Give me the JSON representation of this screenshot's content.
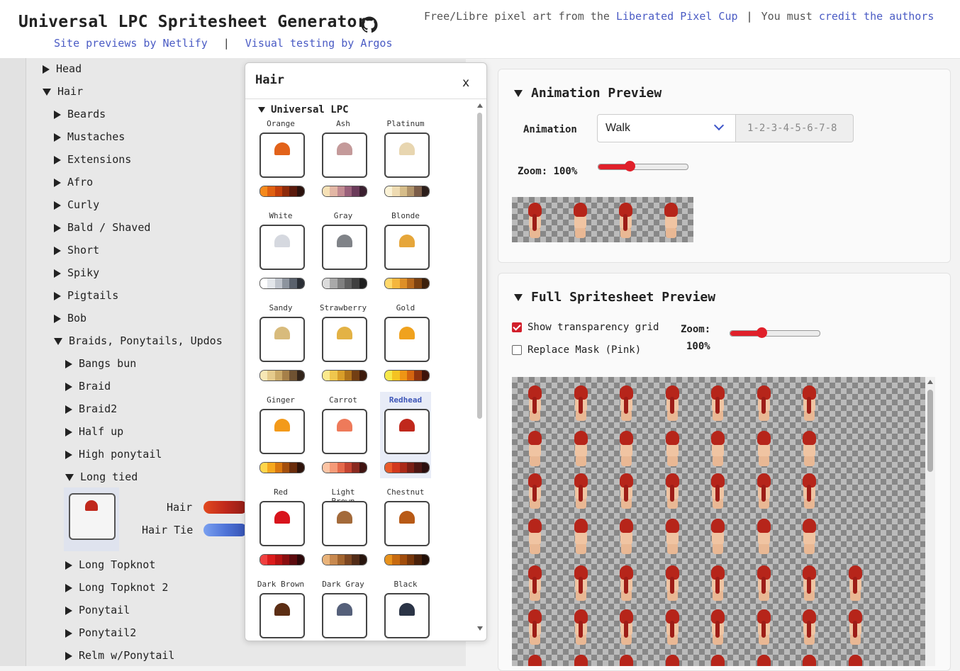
{
  "header": {
    "title": "Universal LPC Spritesheet Generator",
    "link_netlify": "Site previews by Netlify",
    "link_sep": "|",
    "link_argos": "Visual testing by Argos",
    "credit_prefix": "Free/Libre pixel art from the",
    "credit_lpc": "Liberated Pixel Cup",
    "credit_mid": "You must",
    "credit_authors": "credit the authors"
  },
  "tree": {
    "items": [
      {
        "label": "Head",
        "expanded": false
      },
      {
        "label": "Hair",
        "expanded": true
      },
      {
        "label": "Beards",
        "expanded": false
      },
      {
        "label": "Mustaches",
        "expanded": false
      },
      {
        "label": "Extensions",
        "expanded": false
      },
      {
        "label": "Afro",
        "expanded": false
      },
      {
        "label": "Curly",
        "expanded": false
      },
      {
        "label": "Bald / Shaved",
        "expanded": false
      },
      {
        "label": "Short",
        "expanded": false
      },
      {
        "label": "Spiky",
        "expanded": false
      },
      {
        "label": "Pigtails",
        "expanded": false
      },
      {
        "label": "Bob",
        "expanded": false
      },
      {
        "label": "Braids, Ponytails, Updos",
        "expanded": true
      },
      {
        "label": "Bangs bun",
        "expanded": false
      },
      {
        "label": "Braid",
        "expanded": false
      },
      {
        "label": "Braid2",
        "expanded": false
      },
      {
        "label": "Half up",
        "expanded": false
      },
      {
        "label": "High ponytail",
        "expanded": false
      },
      {
        "label": "Long tied",
        "expanded": true
      },
      {
        "label": "Long Topknot",
        "expanded": false
      },
      {
        "label": "Long Topknot 2",
        "expanded": false
      },
      {
        "label": "Ponytail",
        "expanded": false
      },
      {
        "label": "Ponytail2",
        "expanded": false
      },
      {
        "label": "Relm w/Ponytail",
        "expanded": false
      }
    ],
    "selected_labels": {
      "hair": "Hair",
      "hair_tie": "Hair Tie"
    },
    "colors": {
      "hair": "#c83a1e",
      "tie": "#4f74d8"
    }
  },
  "modal": {
    "title": "Hair",
    "close": "x",
    "section": "Universal LPC",
    "selected": "Redhead",
    "variants": [
      {
        "name": "Orange",
        "hair": "#e2621a",
        "pal": [
          "#f58a1c",
          "#e06112",
          "#c3400c",
          "#8e2b0b",
          "#5a1a0c",
          "#2b120d"
        ]
      },
      {
        "name": "Ash",
        "hair": "#c49a9a",
        "pal": [
          "#f6e1b6",
          "#e3b7a5",
          "#c28b92",
          "#99607a",
          "#6b3b5a",
          "#3a1f2f"
        ]
      },
      {
        "name": "Platinum",
        "hair": "#e8d6b0",
        "pal": [
          "#fbf2d6",
          "#eedbb2",
          "#d6bd8a",
          "#b0936a",
          "#7b5d49",
          "#2c1e1a"
        ]
      },
      {
        "name": "White",
        "hair": "#d5d8df",
        "pal": [
          "#ffffff",
          "#e3e6ea",
          "#bfc4cc",
          "#8d949e",
          "#5a616c",
          "#2a2e35"
        ]
      },
      {
        "name": "Gray",
        "hair": "#808388",
        "pal": [
          "#dcdcdc",
          "#a9a9a9",
          "#808080",
          "#5f5f5f",
          "#3f3f3f",
          "#1e1e1e"
        ]
      },
      {
        "name": "Blonde",
        "hair": "#e6a63a",
        "pal": [
          "#ffd86a",
          "#f4b63e",
          "#dd8f28",
          "#b5681c",
          "#7b4212",
          "#3b200c"
        ]
      },
      {
        "name": "Sandy",
        "hair": "#d8bb7c",
        "pal": [
          "#f7e7b5",
          "#e5cb8c",
          "#cbaa68",
          "#a68049",
          "#6f5232",
          "#32241a"
        ]
      },
      {
        "name": "Strawberry",
        "hair": "#e3b245",
        "pal": [
          "#fbe98d",
          "#f0c64e",
          "#d99e29",
          "#b0731a",
          "#733f13",
          "#3d1a0c"
        ]
      },
      {
        "name": "Gold",
        "hair": "#f0a21e",
        "pal": [
          "#f6e84a",
          "#f4c322",
          "#ee9515",
          "#d4650f",
          "#8e330e",
          "#3e130b"
        ]
      },
      {
        "name": "Ginger",
        "hair": "#f39a1a",
        "pal": [
          "#ffd54a",
          "#f6a81f",
          "#d9780f",
          "#a34f0d",
          "#6a2d0c",
          "#2e140b"
        ]
      },
      {
        "name": "Carrot",
        "hair": "#ee7a5a",
        "pal": [
          "#fcc4a4",
          "#f59a78",
          "#e56a4c",
          "#c44431",
          "#8a2a20",
          "#401411"
        ]
      },
      {
        "name": "Redhead",
        "hair": "#c0281c",
        "pal": [
          "#ea5a2a",
          "#d2381e",
          "#aa2a1a",
          "#7a1f17",
          "#4d1614",
          "#2a0e0e"
        ]
      },
      {
        "name": "Red",
        "hair": "#d8141c",
        "pal": [
          "#f04040",
          "#dc1c1c",
          "#b61212",
          "#8a0e10",
          "#5c0b0e",
          "#2c0809"
        ]
      },
      {
        "name": "Light Brown",
        "hair": "#a36a3a",
        "pal": [
          "#e9b37a",
          "#c8894f",
          "#a3652f",
          "#7c4621",
          "#522c17",
          "#28150d"
        ]
      },
      {
        "name": "Chestnut",
        "hair": "#b85a16",
        "pal": [
          "#e8921c",
          "#c76a10",
          "#a14d0c",
          "#76360b",
          "#4a210a",
          "#220f07"
        ]
      },
      {
        "name": "Dark Brown",
        "hair": "#5c2e14",
        "pal": [
          "#a6622a",
          "#874a1c",
          "#683515",
          "#4b2410",
          "#30170b",
          "#170c07"
        ]
      },
      {
        "name": "Dark Gray",
        "hair": "#55607a",
        "pal": [
          "#9aa5bb",
          "#7b8599",
          "#5d6679",
          "#42495a",
          "#2a2f3c",
          "#14171e"
        ]
      },
      {
        "name": "Black",
        "hair": "#2b3446",
        "pal": [
          "#5b6478",
          "#424a5c",
          "#2d3443",
          "#1d222d",
          "#12151c",
          "#08090c"
        ]
      }
    ]
  },
  "animation_preview": {
    "title": "Animation Preview",
    "label": "Animation",
    "selected": "Walk",
    "frames": "1-2-3-4-5-6-7-8",
    "zoom_label": "Zoom: 100%",
    "zoom_value": 0.35
  },
  "full_preview": {
    "title": "Full Spritesheet Preview",
    "show_grid_label": "Show transparency grid",
    "show_grid_checked": true,
    "replace_mask_label": "Replace Mask (Pink)",
    "replace_mask_checked": false,
    "zoom_label": "Zoom:",
    "zoom_value_text": "100%",
    "zoom_value": 0.35
  }
}
